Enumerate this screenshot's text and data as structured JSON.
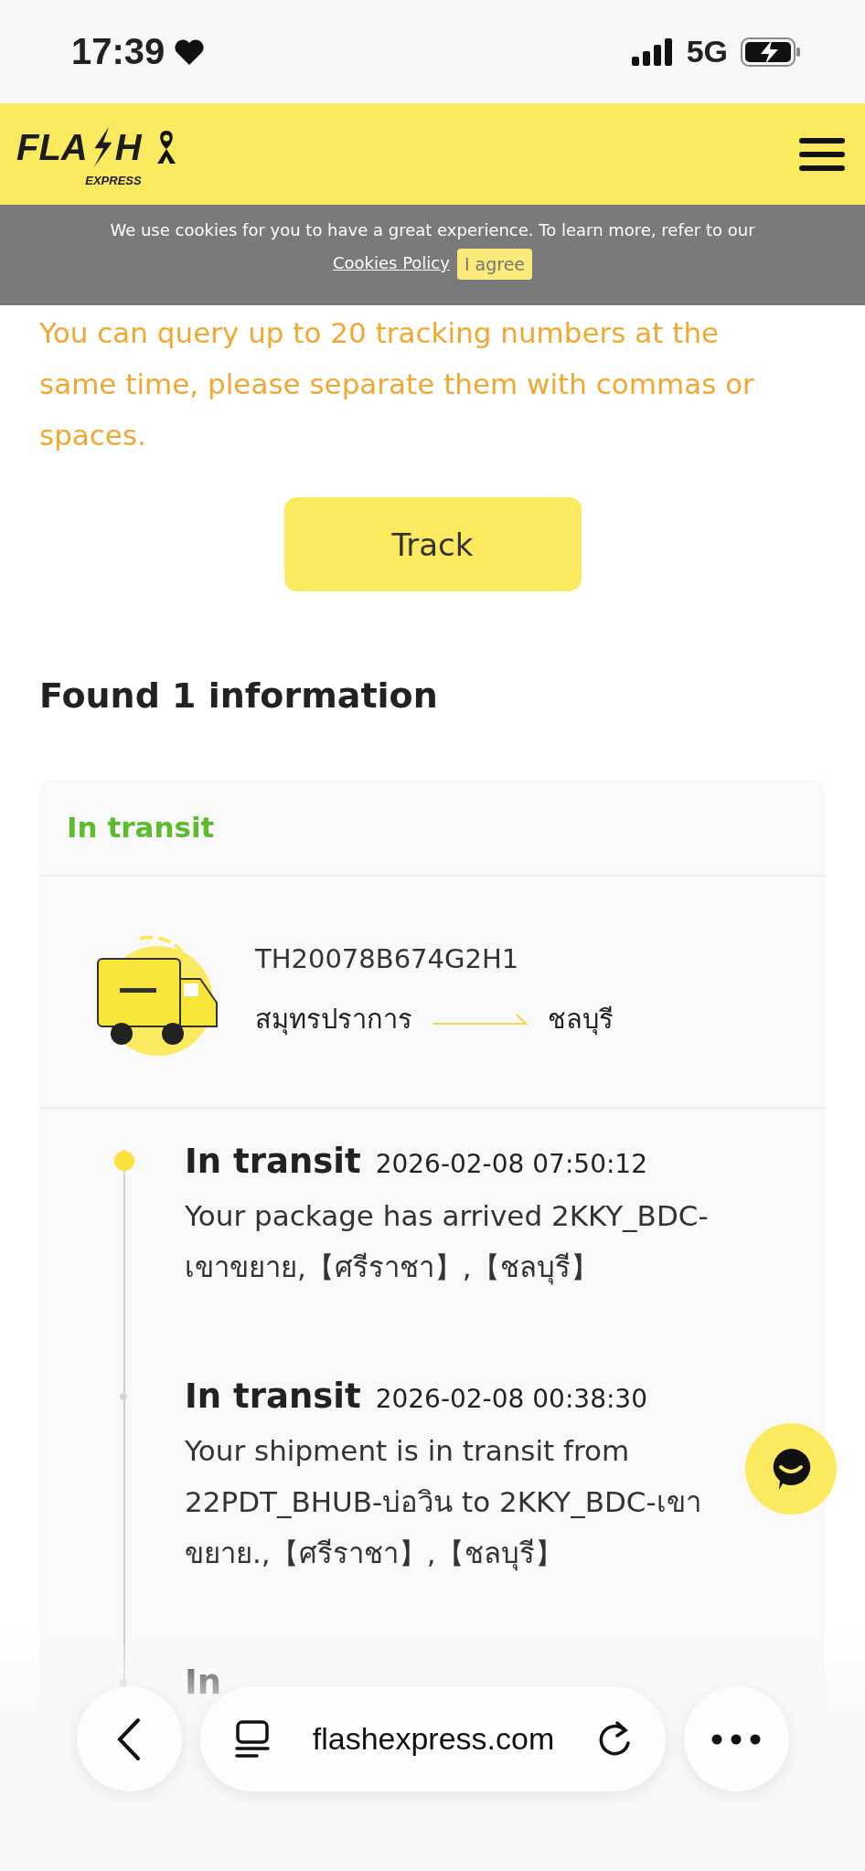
{
  "status_bar": {
    "time": "17:39",
    "network": "5G"
  },
  "header": {
    "logo": {
      "left": "FLA",
      "right": "H",
      "sub": "EXPRESS"
    }
  },
  "cookie_banner": {
    "text": "We use cookies for you to have a great experience. To learn more, refer to our",
    "link": "Cookies Policy",
    "button": "I agree"
  },
  "search": {
    "hint": "You can query up to 20 tracking numbers at the same time, please separate them with commas or spaces.",
    "button": "Track"
  },
  "results_title": "Found 1 information",
  "shipment": {
    "status": "In transit",
    "tracking_number": "TH20078B674G2H1",
    "origin": "สมุทรปราการ",
    "destination": "ชลบุรี",
    "events": [
      {
        "title": "In transit",
        "time": "2026-02-08 07:50:12",
        "description": "Your package has arrived 2KKY_BDC-เขาขยาย,【ศรีราชา】,【ชลบุรี】",
        "latest": true
      },
      {
        "title": "In transit",
        "time": "2026-02-08 00:38:30",
        "description": "Your shipment is in transit from 22PDT_BHUB-บ่อวิน to 2KKY_BDC-เขาขยาย.,【ศรีราชา】,【ชลบุรี】",
        "latest": false
      },
      {
        "title": "In",
        "latest": false
      }
    ]
  },
  "browser_bar": {
    "url": "flashexpress.com"
  }
}
